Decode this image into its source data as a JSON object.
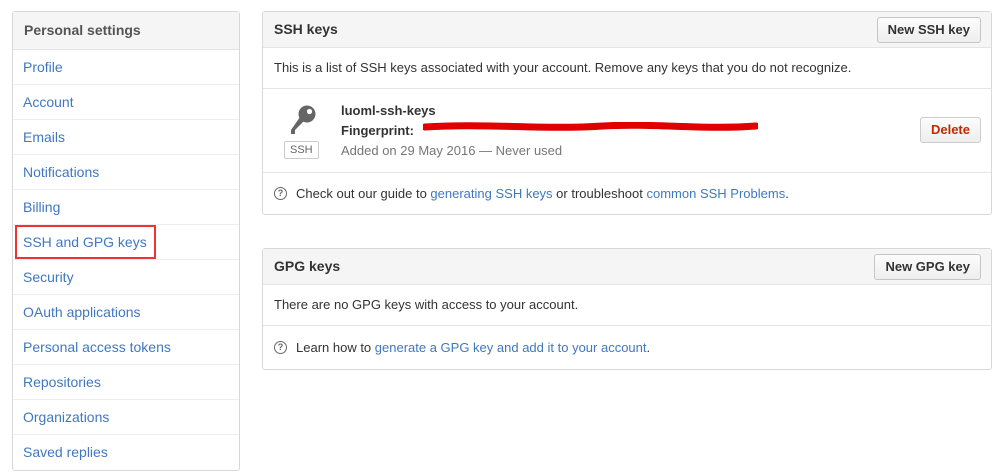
{
  "sidebar": {
    "header": "Personal settings",
    "items": [
      {
        "label": "Profile"
      },
      {
        "label": "Account"
      },
      {
        "label": "Emails"
      },
      {
        "label": "Notifications"
      },
      {
        "label": "Billing"
      },
      {
        "label": "SSH and GPG keys"
      },
      {
        "label": "Security"
      },
      {
        "label": "OAuth applications"
      },
      {
        "label": "Personal access tokens"
      },
      {
        "label": "Repositories"
      },
      {
        "label": "Organizations"
      },
      {
        "label": "Saved replies"
      }
    ]
  },
  "ssh": {
    "title": "SSH keys",
    "new_button": "New SSH key",
    "description": "This is a list of SSH keys associated with your account. Remove any keys that you do not recognize.",
    "key": {
      "name": "luoml-ssh-keys",
      "fingerprint_label": "Fingerprint:",
      "badge": "SSH",
      "added": "Added on 29 May 2016 — Never used",
      "delete_label": "Delete"
    },
    "help": {
      "prefix": "Check out our guide to ",
      "link1": "generating SSH keys",
      "middle": " or troubleshoot ",
      "link2": "common SSH Problems",
      "suffix": "."
    }
  },
  "gpg": {
    "title": "GPG keys",
    "new_button": "New GPG key",
    "empty": "There are no GPG keys with access to your account.",
    "help": {
      "prefix": "Learn how to ",
      "link": "generate a GPG key and add it to your account",
      "suffix": "."
    }
  },
  "colors": {
    "link": "#4078c0",
    "danger": "#bd2c00",
    "highlight": "#e33333",
    "redaction": "#e00000"
  }
}
